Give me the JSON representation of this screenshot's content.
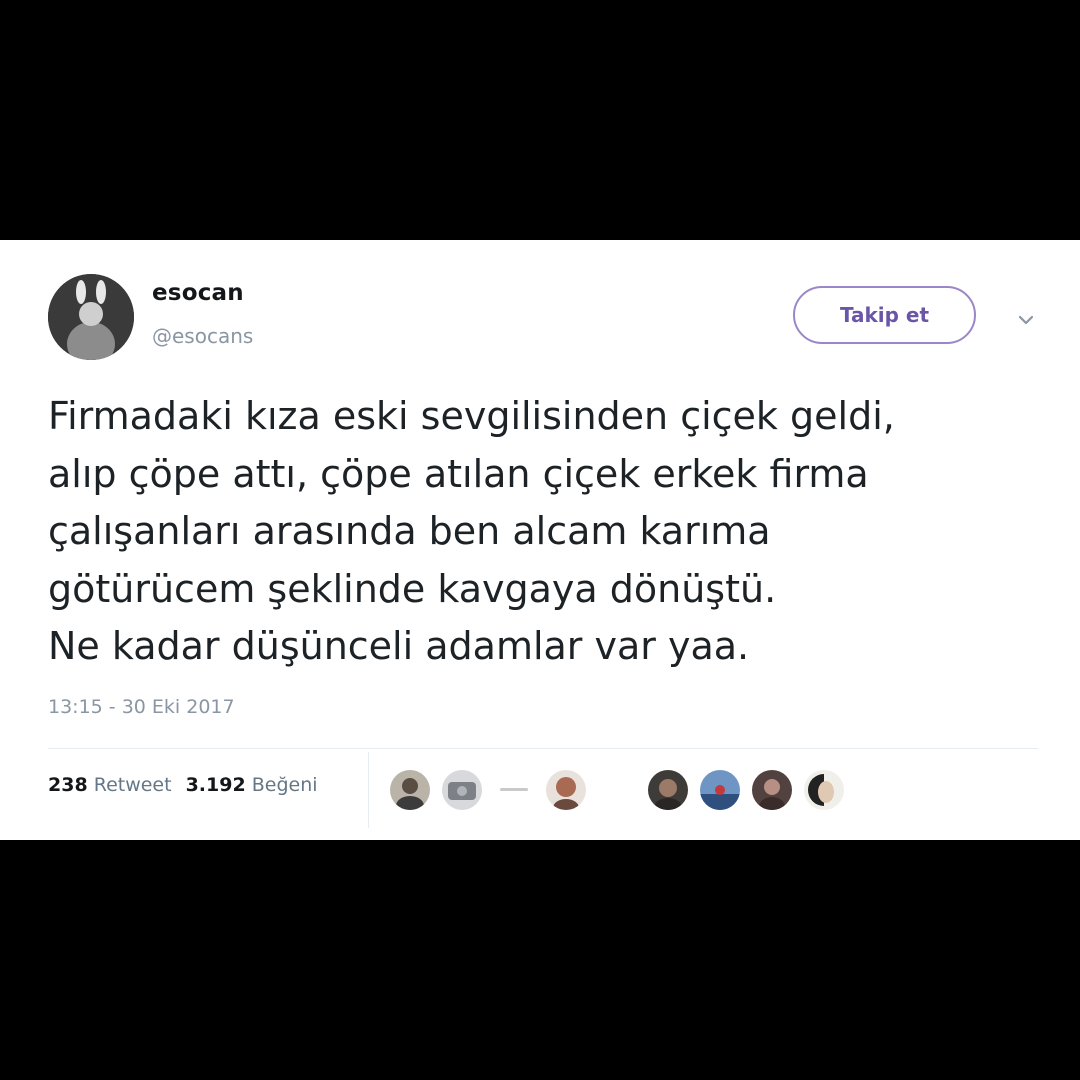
{
  "tweet": {
    "display_name": "esocan",
    "handle": "@esocans",
    "follow_label": "Takip et",
    "menu_icon": "chevron-down-icon",
    "text_lines": [
      "Firmadaki kıza eski sevgilisinden çiçek geldi,",
      "alıp çöpe attı, çöpe atılan çiçek erkek firma",
      "çalışanları arasında ben alcam karıma",
      "götürücem şeklinde kavgaya dönüştü.",
      "Ne kadar düşünceli adamlar var yaa."
    ],
    "timestamp": "13:15 - 30 Eki 2017"
  },
  "stats": {
    "retweet_count": "238",
    "retweet_label": "Retweet",
    "like_count": "3.192",
    "like_label": "Beğeni"
  },
  "colors": {
    "follow_accent": "#6a56a8",
    "muted_text": "#8a96a3",
    "body_text": "#1c2226",
    "frame": "#000000"
  }
}
